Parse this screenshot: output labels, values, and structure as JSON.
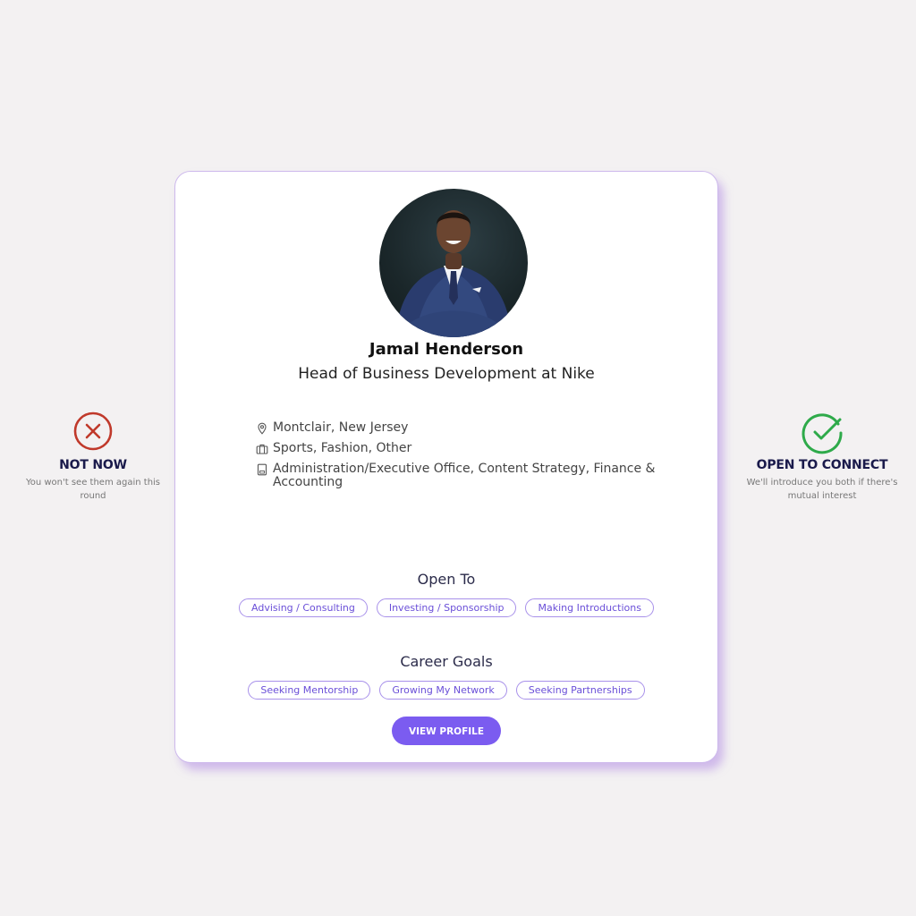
{
  "actions": {
    "not_now": {
      "title": "NOT NOW",
      "subtitle": "You won't see them again this round",
      "color": "#c0392b"
    },
    "open_to_connect": {
      "title": "OPEN TO CONNECT",
      "subtitle": "We'll introduce you both if there's mutual interest",
      "color": "#2eaa4a"
    }
  },
  "profile": {
    "name": "Jamal Henderson",
    "headline": "Head of Business Development at Nike",
    "details": {
      "location": "Montclair, New Jersey",
      "industries": "Sports, Fashion, Other",
      "functions": "Administration/Executive Office, Content Strategy, Finance & Accounting"
    },
    "open_to": {
      "title": "Open To",
      "tags": [
        "Advising / Consulting",
        "Investing / Sponsorship",
        "Making Introductions"
      ]
    },
    "career_goals": {
      "title": "Career Goals",
      "tags": [
        "Seeking Mentorship",
        "Growing My Network",
        "Seeking Partnerships"
      ]
    },
    "view_profile_label": "VIEW PROFILE"
  },
  "icons": {
    "location": "location-pin-icon",
    "industries": "briefcase-icon",
    "functions": "building-icon",
    "reject": "close-circle-icon",
    "accept": "check-circle-icon"
  },
  "colors": {
    "accent": "#7b5cf0",
    "tag_border": "#a891ea",
    "card_shadow": "#b28ce4",
    "background": "#f3f1f2",
    "title_text": "#1a1a4b"
  }
}
